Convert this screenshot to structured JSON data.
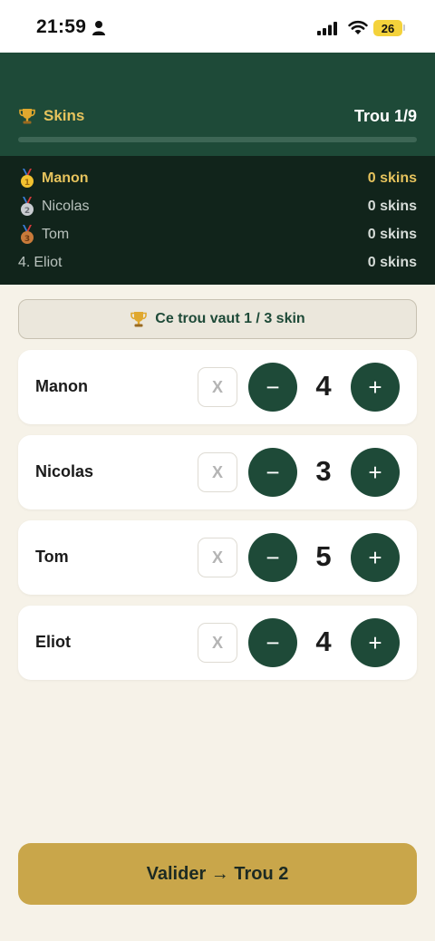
{
  "status_bar": {
    "time": "21:59",
    "battery": "26"
  },
  "header": {
    "title": "Skins",
    "hole": "Trou 1/9",
    "progress": 0
  },
  "leaderboard": [
    {
      "rank": "1",
      "name": "Manon",
      "skins": "0 skins",
      "medal": "gold-medal-icon"
    },
    {
      "rank": "2",
      "name": "Nicolas",
      "skins": "0 skins",
      "medal": "silver-medal-icon"
    },
    {
      "rank": "3",
      "name": "Tom",
      "skins": "0 skins",
      "medal": "bronze-medal-icon"
    },
    {
      "rank": "4.",
      "name": "Eliot",
      "skins": "0 skins",
      "medal": null
    }
  ],
  "banner": {
    "text": "Ce trou vaut 1 / 3 skin"
  },
  "players": [
    {
      "name": "Manon",
      "score": "4",
      "x_label": "X",
      "minus": "−",
      "plus": "+"
    },
    {
      "name": "Nicolas",
      "score": "3",
      "x_label": "X",
      "minus": "−",
      "plus": "+"
    },
    {
      "name": "Tom",
      "score": "5",
      "x_label": "X",
      "minus": "−",
      "plus": "+"
    },
    {
      "name": "Eliot",
      "score": "4",
      "x_label": "X",
      "minus": "−",
      "plus": "+"
    }
  ],
  "validate": {
    "label": "Valider → Trou 2"
  },
  "colors": {
    "primary": "#1e4a38",
    "gold": "#e6c35d",
    "button": "#c9a64a"
  }
}
